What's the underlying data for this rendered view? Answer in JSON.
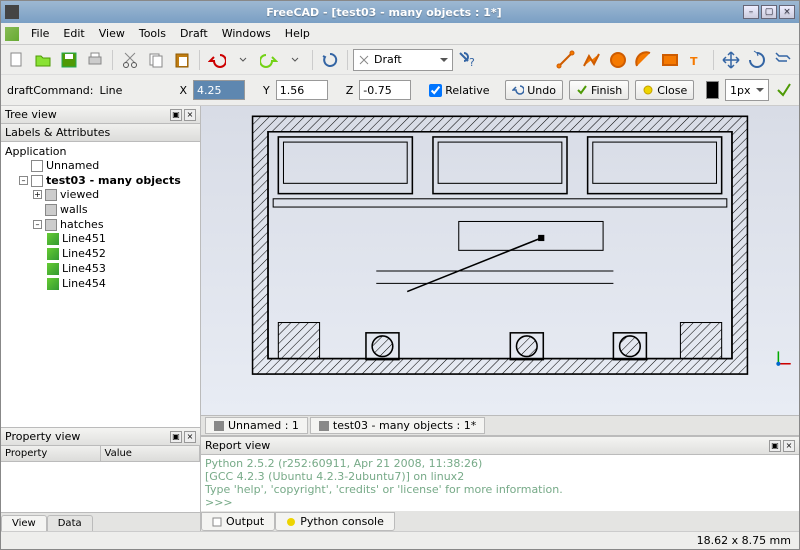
{
  "titlebar": {
    "title": "FreeCAD - [test03 - many objects : 1*]"
  },
  "menu": {
    "items": [
      "File",
      "Edit",
      "View",
      "Tools",
      "Draft",
      "Windows",
      "Help"
    ]
  },
  "toolbar1": {
    "workbench": "Draft"
  },
  "draft": {
    "command_label": "draftCommand:",
    "command": "Line",
    "x_label": "X",
    "x": "4.25",
    "y_label": "Y",
    "y": "1.56",
    "z_label": "Z",
    "z": "-0.75",
    "relative_label": "Relative",
    "undo": "Undo",
    "finish": "Finish",
    "close": "Close",
    "stroke_width": "1px",
    "color": "#000000"
  },
  "tree": {
    "title": "Tree view",
    "labels": "Labels & Attributes",
    "root": "Application",
    "items": [
      {
        "label": "Unnamed",
        "icon": "doc"
      },
      {
        "label": "test03 - many objects",
        "icon": "doc",
        "bold": true,
        "expanded": true,
        "children": [
          {
            "label": "viewed",
            "icon": "folder",
            "expander": "+"
          },
          {
            "label": "walls",
            "icon": "folder"
          },
          {
            "label": "hatches",
            "icon": "folder",
            "expander": "-",
            "children": [
              {
                "label": "Line451",
                "icon": "line"
              },
              {
                "label": "Line452",
                "icon": "line"
              },
              {
                "label": "Line453",
                "icon": "line"
              },
              {
                "label": "Line454",
                "icon": "line"
              }
            ]
          }
        ]
      }
    ]
  },
  "propview": {
    "title": "Property view",
    "cols": [
      "Property",
      "Value"
    ],
    "tabs": [
      "View",
      "Data"
    ]
  },
  "doctabs": [
    {
      "label": "Unnamed : 1"
    },
    {
      "label": "test03 - many objects : 1*"
    }
  ],
  "report": {
    "title": "Report view",
    "lines": [
      "Python 2.5.2 (r252:60911, Apr 21 2008, 11:38:26)",
      "[GCC 4.2.3 (Ubuntu 4.2.3-2ubuntu7)] on linux2",
      "Type 'help', 'copyright', 'credits' or 'license' for more information.",
      ">>>"
    ],
    "tabs": [
      "Output",
      "Python console"
    ]
  },
  "status": {
    "coords": "18.62 x 8.75 mm"
  }
}
